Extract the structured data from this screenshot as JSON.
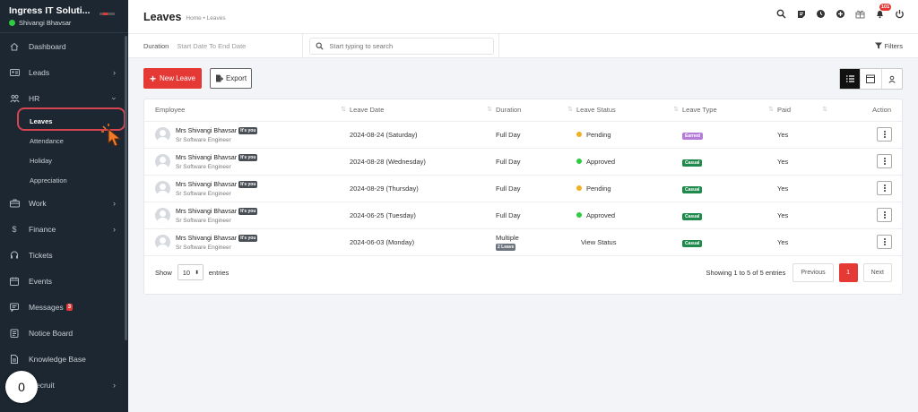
{
  "sidebar": {
    "company": "Ingress IT Soluti...",
    "user": "Shivangi Bhavsar",
    "items": [
      {
        "label": "Dashboard",
        "icon": "home-icon"
      },
      {
        "label": "Leads",
        "icon": "id-card-icon"
      },
      {
        "label": "HR",
        "icon": "users-icon"
      },
      {
        "label": "Work",
        "icon": "briefcase-icon"
      },
      {
        "label": "Finance",
        "icon": "dollar-icon"
      },
      {
        "label": "Tickets",
        "icon": "headset-icon"
      },
      {
        "label": "Events",
        "icon": "calendar-icon"
      },
      {
        "label": "Messages",
        "icon": "chat-icon",
        "badge": "3"
      },
      {
        "label": "Notice Board",
        "icon": "clipboard-icon"
      },
      {
        "label": "Knowledge Base",
        "icon": "document-icon"
      },
      {
        "label": "ecruit",
        "icon": "recruit-icon"
      }
    ],
    "hr_subitems": [
      "Leaves",
      "Attendance",
      "Holiday",
      "Appreciation"
    ],
    "counter": "0"
  },
  "header": {
    "title": "Leaves",
    "breadcrumb": "Home • Leaves",
    "notification_count": "101"
  },
  "filters": {
    "duration_label": "Duration",
    "duration_value": "Start Date To End Date",
    "search_placeholder": "Start typing to search",
    "filters_label": "Filters"
  },
  "actions": {
    "new_leave": "New Leave",
    "export": "Export"
  },
  "table": {
    "columns": [
      "Employee",
      "Leave Date",
      "Duration",
      "Leave Status",
      "Leave Type",
      "Paid",
      "Action"
    ],
    "rows": [
      {
        "name": "Mrs Shivangi Bhavsar",
        "tag": "It's you",
        "role": "Sr Software Engineer",
        "date": "2024-08-24 (Saturday)",
        "duration": "Full Day",
        "duration_badge": "",
        "status": "Pending",
        "type": "Earned",
        "paid": "Yes"
      },
      {
        "name": "Mrs Shivangi Bhavsar",
        "tag": "It's you",
        "role": "Sr Software Engineer",
        "date": "2024-08-28 (Wednesday)",
        "duration": "Full Day",
        "duration_badge": "",
        "status": "Approved",
        "type": "Casual",
        "paid": "Yes"
      },
      {
        "name": "Mrs Shivangi Bhavsar",
        "tag": "It's you",
        "role": "Sr Software Engineer",
        "date": "2024-08-29 (Thursday)",
        "duration": "Full Day",
        "duration_badge": "",
        "status": "Pending",
        "type": "Casual",
        "paid": "Yes"
      },
      {
        "name": "Mrs Shivangi Bhavsar",
        "tag": "It's you",
        "role": "Sr Software Engineer",
        "date": "2024-06-25 (Tuesday)",
        "duration": "Full Day",
        "duration_badge": "",
        "status": "Approved",
        "type": "Casual",
        "paid": "Yes"
      },
      {
        "name": "Mrs Shivangi Bhavsar",
        "tag": "It's you",
        "role": "Sr Software Engineer",
        "date": "2024-06-03 (Monday)",
        "duration": "Multiple",
        "duration_badge": "2 Leave",
        "status": "View Status",
        "type": "Casual",
        "paid": "Yes"
      }
    ]
  },
  "pagination": {
    "show_label": "Show",
    "page_size": "10",
    "entries_label": "entries",
    "info": "Showing 1 to 5 of 5 entries",
    "previous": "Previous",
    "current_page": "1",
    "next": "Next"
  },
  "colors": {
    "accent": "#e53935",
    "sidebar_bg": "#1d2731",
    "pending": "#f2b01e",
    "approved": "#2ecc40",
    "earned": "#b57bd8",
    "casual": "#1f8a4c"
  }
}
